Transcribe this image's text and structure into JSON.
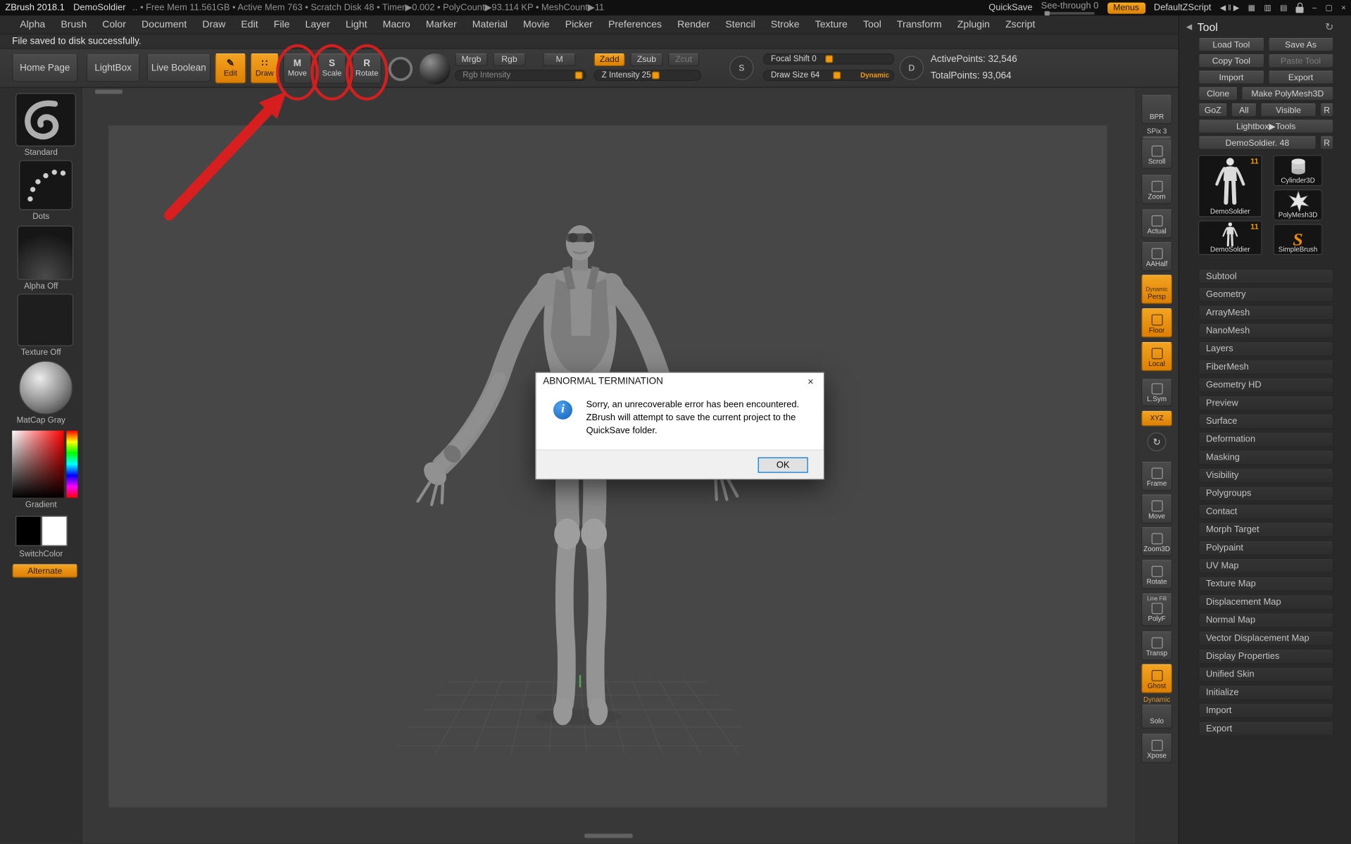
{
  "titlebar": {
    "app_title": "ZBrush 2018.1",
    "document_name": "DemoSoldier",
    "stats": ".. • Free Mem 11.561GB • Active Mem 763 • Scratch Disk 48 • Timer▶0.002 • PolyCount▶93.114 KP • MeshCount▶11",
    "quicksave_label": "QuickSave",
    "seethrough_label": "See-through 0",
    "menus_label": "Menus",
    "zscript_label": "DefaultZScript",
    "icons": {
      "transport": "◀ ‖ ▶",
      "grid_a": "▦",
      "grid_b": "▥",
      "grid_c": "▤",
      "minimize": "–",
      "restore": "▢",
      "close": "×"
    }
  },
  "menubar": {
    "items": [
      "Alpha",
      "Brush",
      "Color",
      "Document",
      "Draw",
      "Edit",
      "File",
      "Layer",
      "Light",
      "Macro",
      "Marker",
      "Material",
      "Movie",
      "Picker",
      "Preferences",
      "Render",
      "Stencil",
      "Stroke",
      "Texture",
      "Tool",
      "Transform",
      "Zplugin",
      "Zscript"
    ]
  },
  "status_message": "File saved to disk successfully.",
  "topshelf": {
    "home_page": "Home Page",
    "lightbox": "LightBox",
    "live_boolean": "Live Boolean",
    "edit": "Edit",
    "edit_glyph": "✎",
    "draw": "Draw",
    "draw_glyph": "∷",
    "move": "Move",
    "move_glyph": "M",
    "scale": "Scale",
    "scale_glyph": "S",
    "rotate": "Rotate",
    "rotate_glyph": "R",
    "mrgb": "Mrgb",
    "rgb": "Rgb",
    "m": "M",
    "zadd": "Zadd",
    "zsub": "Zsub",
    "zcut": "Zcut",
    "rgb_intensity": "Rgb Intensity",
    "z_intensity": "Z Intensity 25",
    "focal_shift": "Focal Shift 0",
    "draw_size": "Draw Size 64",
    "dynamic": "Dynamic",
    "s_dial": "S",
    "d_dial": "D",
    "active_points": "ActivePoints: 32,546",
    "total_points": "TotalPoints: 93,064"
  },
  "left_palette": {
    "brush_label": "Standard",
    "stroke_label": "Dots",
    "alpha_label": "Alpha Off",
    "texture_label": "Texture Off",
    "material_label": "MatCap Gray",
    "gradient_label": "Gradient",
    "switch_label": "SwitchColor",
    "alternate_label": "Alternate"
  },
  "right_shelf": {
    "bpr": "BPR",
    "spix": "SPix 3",
    "scroll": "Scroll",
    "zoom": "Zoom",
    "actual": "Actual",
    "aahalf": "AAHalf",
    "persp_sub": "Dynamic",
    "persp": "Persp",
    "floor": "Floor",
    "local": "Local",
    "lsym": "L.Sym",
    "xyz": "XYZ",
    "gyro_glyph": "↻",
    "frame": "Frame",
    "move": "Move",
    "zoom3d": "Zoom3D",
    "rotate": "Rotate",
    "linefill_sub": "Line Fill",
    "polyf": "PolyF",
    "transp": "Transp",
    "ghost": "Ghost",
    "dynamic_label": "Dynamic",
    "solo": "Solo",
    "xpose": "Xpose"
  },
  "tool_panel": {
    "collapse_glyph": "◀",
    "title": "Tool",
    "history_glyph": "↻",
    "buttons": {
      "load_tool": "Load Tool",
      "save_as": "Save As",
      "copy_tool": "Copy Tool",
      "paste_tool": "Paste Tool",
      "import": "Import",
      "export": "Export",
      "clone": "Clone",
      "make_polymesh": "Make PolyMesh3D",
      "goz": "GoZ",
      "all": "All",
      "visible": "Visible",
      "r": "R",
      "lightbox_tools": "Lightbox▶Tools",
      "current_tool": "DemoSoldier. 48",
      "r2": "R"
    },
    "thumbnails": {
      "demosoldier": "DemoSoldier",
      "demosoldier_badge": "11",
      "cylinder": "Cylinder3D",
      "polymesh": "PolyMesh3D",
      "demosoldier2": "DemoSoldier",
      "demosoldier2_badge": "11",
      "simplebrush": "SimpleBrush",
      "simplebrush_glyph": "S"
    },
    "sections": [
      "Subtool",
      "Geometry",
      "ArrayMesh",
      "NanoMesh",
      "Layers",
      "FiberMesh",
      "Geometry HD",
      "Preview",
      "Surface",
      "Deformation",
      "Masking",
      "Visibility",
      "Polygroups",
      "Contact",
      "Morph Target",
      "Polypaint",
      "UV Map",
      "Texture Map",
      "Displacement Map",
      "Normal Map",
      "Vector Displacement Map",
      "Display Properties",
      "Unified Skin",
      "Initialize",
      "Import",
      "Export"
    ]
  },
  "dialog": {
    "title": "ABNORMAL TERMINATION",
    "close_glyph": "×",
    "info_glyph": "i",
    "message": "Sorry, an unrecoverable error has been encountered. ZBrush will attempt to save the current project to the QuickSave folder.",
    "ok_label": "OK"
  },
  "colors": {
    "accent_orange": "#f09a10",
    "annotation_red": "#e01d1d",
    "dialog_focus_blue": "#0078d7"
  }
}
